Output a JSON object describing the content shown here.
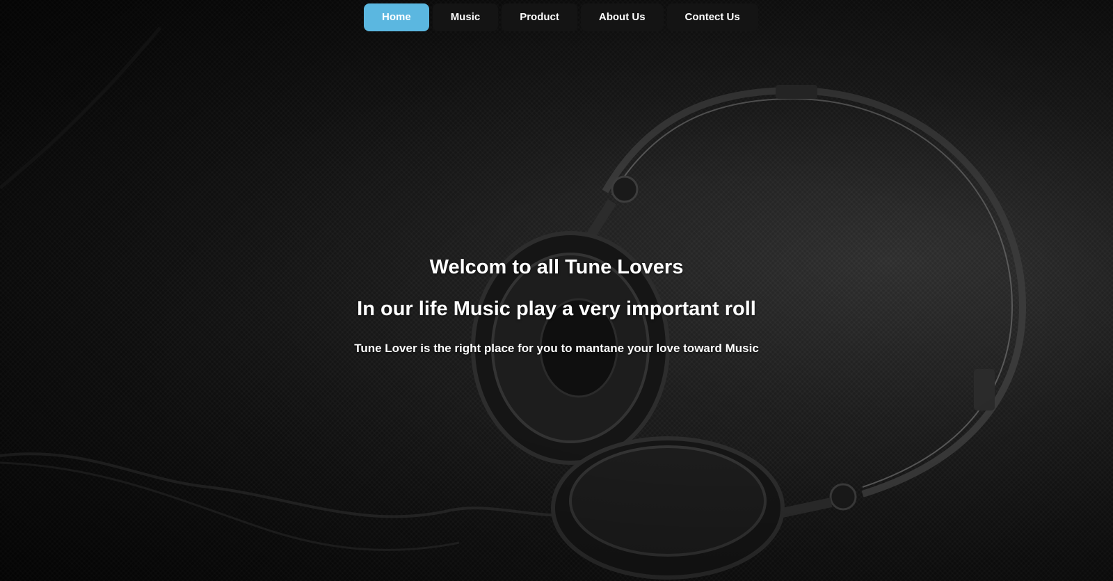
{
  "nav": {
    "items": [
      {
        "label": "Home",
        "active": true
      },
      {
        "label": "Music",
        "active": false
      },
      {
        "label": "Product",
        "active": false
      },
      {
        "label": "About Us",
        "active": false
      },
      {
        "label": "Contect Us",
        "active": false
      }
    ],
    "active_color": "#5bb7e0",
    "item_color": "#141414"
  },
  "hero": {
    "welcome": "Welcom to all Tune Lovers",
    "headline": "In our life Music play a very important roll",
    "tagline": "Tune Lover is the right place for you to mantane your love toward Music"
  },
  "background": {
    "image_subject": "headphones-on-dark-surface"
  }
}
